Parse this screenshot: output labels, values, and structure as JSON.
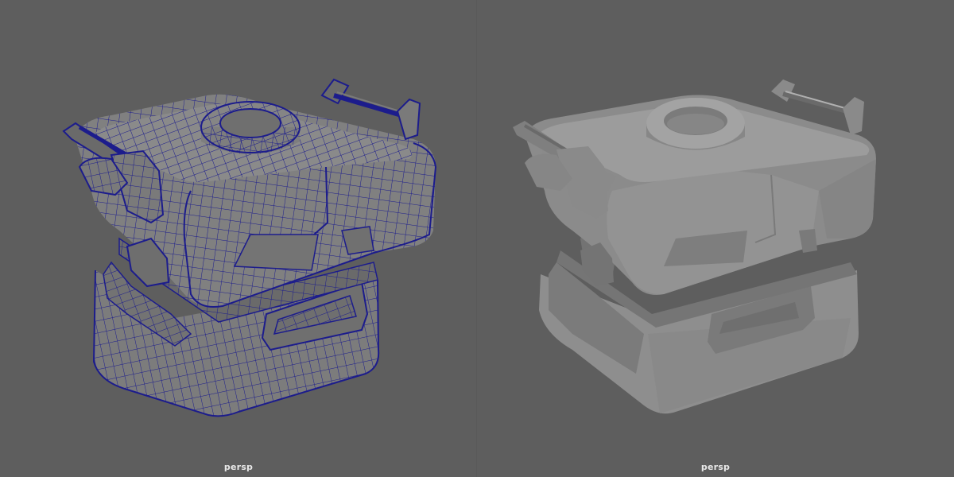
{
  "viewports": [
    {
      "camera": "persp",
      "display_mode": "wireframe-on-shaded",
      "wire_color": "#1c1c8c"
    },
    {
      "camera": "persp",
      "display_mode": "smooth-shaded"
    }
  ],
  "colors": {
    "viewport_bg": "#5e5e5e",
    "mesh_shade": "#8a8a8a",
    "wireframe": "#1c1c8c"
  }
}
